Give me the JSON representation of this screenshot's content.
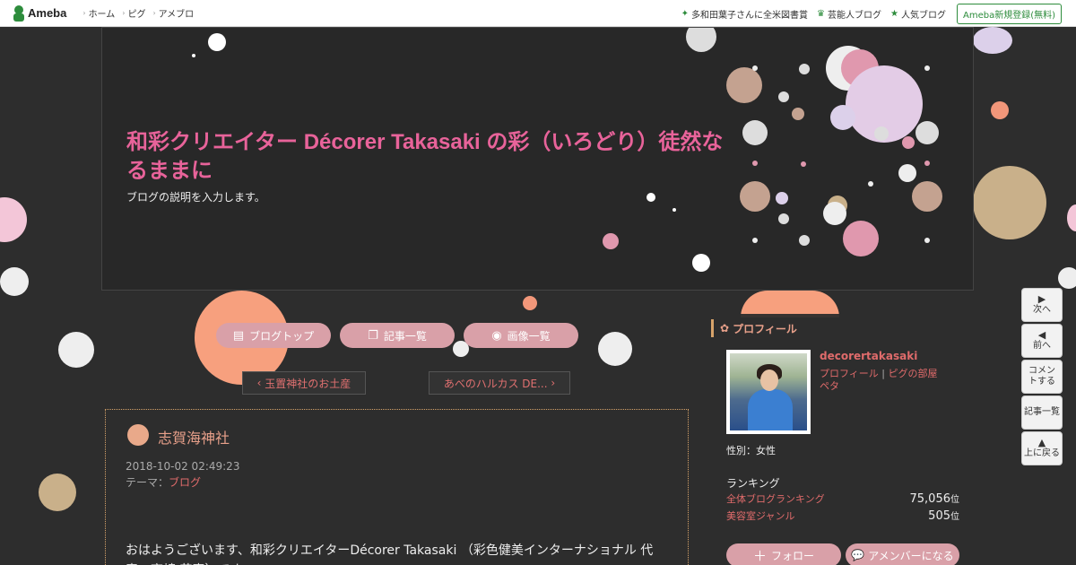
{
  "topbar": {
    "logo_text": "Ameba",
    "nav": [
      "ホーム",
      "ピグ",
      "アメブロ"
    ],
    "right_links": [
      {
        "icon": "sparkle-icon",
        "label": "多和田葉子さんに全米図書賞"
      },
      {
        "icon": "crown-icon",
        "label": "芸能人ブログ"
      },
      {
        "icon": "star-icon",
        "label": "人気ブログ"
      }
    ],
    "register_label": "Ameba新規登録(無料)"
  },
  "header": {
    "title": "和彩クリエイター Décorer Takasaki の彩（いろどり）徒然なるままに",
    "description": "ブログの説明を入力します。"
  },
  "nav_buttons": [
    {
      "icon": "document-icon",
      "label": "ブログトップ"
    },
    {
      "icon": "copy-icon",
      "label": "記事一覧"
    },
    {
      "icon": "camera-icon",
      "label": "画像一覧"
    }
  ],
  "pager": {
    "prev_label": "玉置神社のお土産",
    "next_label": "あべのハルカス DE..."
  },
  "article": {
    "title": "志賀海神社",
    "date": "2018-10-02 02:49:23",
    "theme_label": "テーマ：",
    "theme_value": "ブログ",
    "body": "おはようございます、和彩クリエイターDécorer Takasaki （彩色健美インターナショナル 代表　高崎 花恵）です。"
  },
  "sidebar": {
    "heading": "プロフィール",
    "name": "decorertakasaki",
    "link_profile": "プロフィール",
    "link_sep": "|",
    "link_room": "ピグの部屋",
    "link_extra": "ペタ",
    "gender": "性別：女性",
    "ranking_title": "ランキング",
    "rankings": [
      {
        "label": "全体ブログランキング",
        "value": "75,056",
        "unit": "位"
      },
      {
        "label": "美容室ジャンル",
        "value": "505",
        "unit": "位"
      }
    ],
    "follow_label": "フォロー",
    "member_label": "アメンバーになる"
  },
  "float_nav": [
    {
      "icon": "play-right-icon",
      "label": "次へ"
    },
    {
      "icon": "play-left-icon",
      "label": "前へ"
    },
    {
      "icon": "",
      "label": "コメントする"
    },
    {
      "icon": "",
      "label": "記事一覧"
    },
    {
      "icon": "triangle-up-icon",
      "label": "上に戻る"
    }
  ],
  "colors": {
    "background": "#2d2d2d",
    "title_pink": "#e8639a",
    "accent_red": "#e06b6b",
    "pill_pink": "#d9a0a8",
    "brand_green": "#2d8c3c"
  }
}
